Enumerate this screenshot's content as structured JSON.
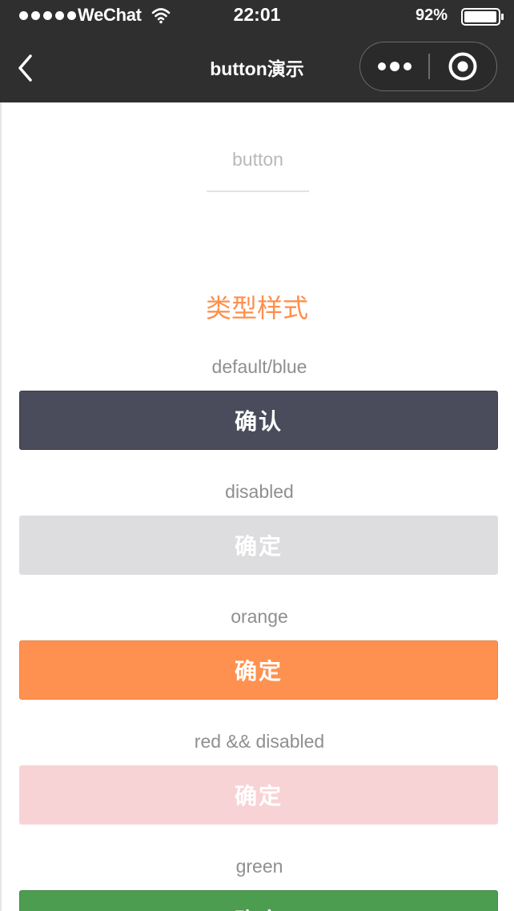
{
  "status_bar": {
    "carrier": "WeChat",
    "time": "22:01",
    "battery": "92%"
  },
  "nav": {
    "title": "button演示"
  },
  "tab": {
    "label": "button"
  },
  "section": {
    "title": "类型样式"
  },
  "demos": [
    {
      "label": "default/blue",
      "button": "确认",
      "color": "#4a4c5b",
      "state": "enabled"
    },
    {
      "label": "disabled",
      "button": "确定",
      "color": "#dddddf",
      "state": "disabled"
    },
    {
      "label": "orange",
      "button": "确定",
      "color": "#ff9150",
      "state": "enabled"
    },
    {
      "label": "red && disabled",
      "button": "确定",
      "color": "#f8d3d5",
      "state": "disabled"
    },
    {
      "label": "green",
      "button": "确定",
      "color": "#4c9d4f",
      "state": "enabled"
    }
  ],
  "icons": {
    "back": "chevron-left-icon",
    "more": "more-dots-icon",
    "close": "target-circle-icon",
    "wifi": "wifi-icon",
    "battery": "battery-icon"
  }
}
